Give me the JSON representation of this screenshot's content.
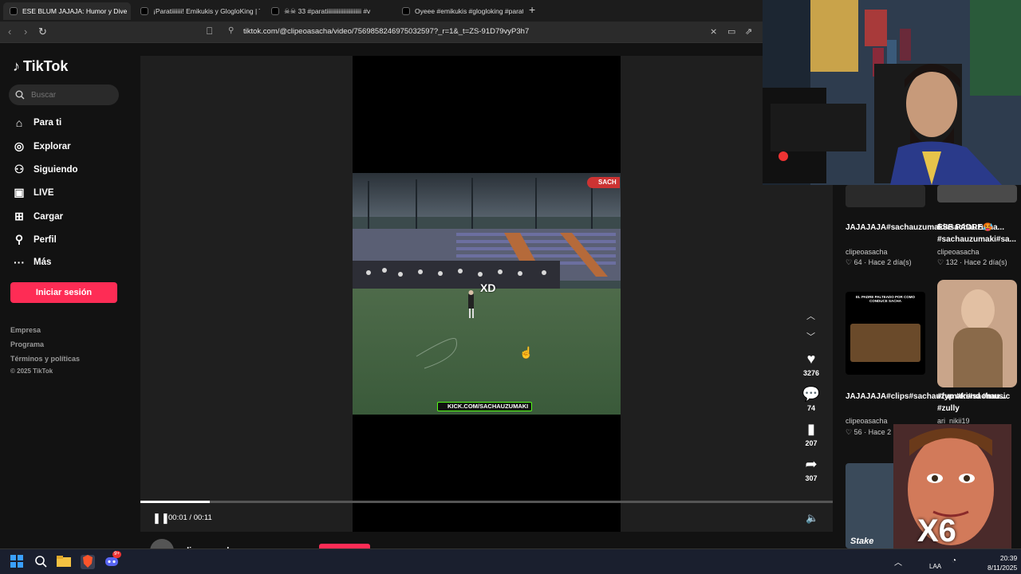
{
  "browser": {
    "tabs": [
      {
        "label": "ESE BLUM JAJAJA: Humor y Dive",
        "active": true
      },
      {
        "label": "¡Paratiiiiiii! Emikukis y GlogloKing | T",
        "active": false
      },
      {
        "label": "☠☠ 33 #paratiiiiiiiiiiiiiiiiiiiiiii #v",
        "active": false
      },
      {
        "label": "Oyeee #emikukis #glogloking #parat",
        "active": false
      }
    ],
    "url": "tiktok.com/@clipeoasacha/video/7569858246975032597?_r=1&_t=ZS-91D79vyP3h7"
  },
  "sidebar": {
    "logo": "TikTok",
    "search_placeholder": "Buscar",
    "items": [
      {
        "label": "Para ti",
        "icon": "home-icon"
      },
      {
        "label": "Explorar",
        "icon": "compass-icon"
      },
      {
        "label": "Siguiendo",
        "icon": "following-icon"
      },
      {
        "label": "LIVE",
        "icon": "live-icon"
      },
      {
        "label": "Cargar",
        "icon": "upload-icon"
      },
      {
        "label": "Perfil",
        "icon": "profile-icon"
      },
      {
        "label": "Más",
        "icon": "more-icon"
      }
    ],
    "login_label": "Iniciar sesión",
    "footer": [
      "Empresa",
      "Programa",
      "Términos y políticas",
      "© 2025 TikTok"
    ]
  },
  "video": {
    "overlay_text": "XD",
    "watermark": "KICK.COM/SACHAUZUMAKI",
    "badge": "SACH",
    "time": "00:01 / 00:11",
    "progress": 0.1
  },
  "actions": {
    "likes": "3276",
    "comments": "74",
    "saves": "207",
    "shares": "307"
  },
  "author": {
    "name": "clipeoasacha"
  },
  "recommended": [
    {
      "title": "JAJAJAJA#sachauzumaki#sachauzuma...",
      "user": "clipeoasacha",
      "stats": "♡ 64 · Hace 2 día(s)"
    },
    {
      "title": "ESE PADRE🥵 #sachauzumaki#sa...",
      "user": "clipeoasacha",
      "stats": "♡ 132 · Hace 2 día(s)"
    },
    {
      "title": "JAJAJAJA#clips#sachauzumaki#sachau...",
      "user": "clipeoasacha",
      "stats": "♡ 56 · Hace 2"
    },
    {
      "title": "#fyp #trend #music #zully",
      "user": "ari_nikii19",
      "stats": ""
    }
  ],
  "thumb_captions": {
    "card3": "EL PADRE PALTEADO POR COMO CONDUCE SACHA",
    "meme": "X6",
    "stake": "Stake"
  },
  "taskbar": {
    "lang": "LAA",
    "time": "20:39",
    "date": "8/11/2025",
    "badge": "9+"
  }
}
